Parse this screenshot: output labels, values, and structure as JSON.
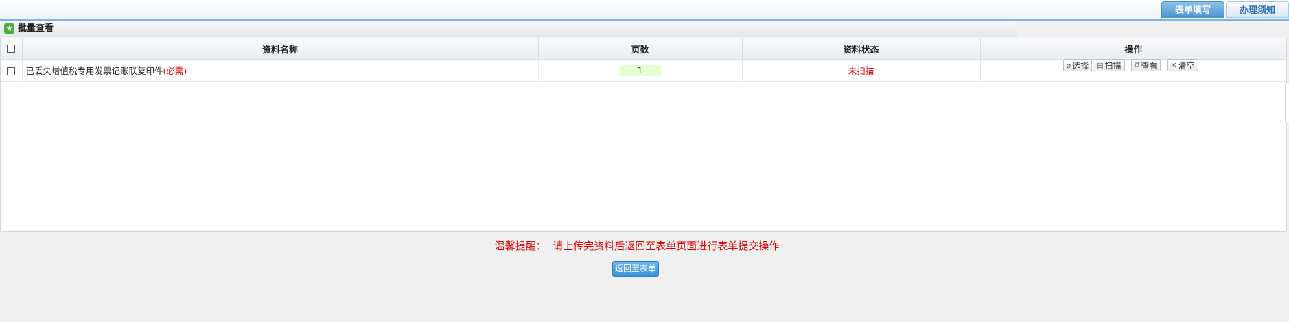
{
  "tabs": [
    {
      "label": "表单填写",
      "active": true
    },
    {
      "label": "办理须知",
      "active": false
    }
  ],
  "batch": {
    "label": "批量查看",
    "icon": "star-icon"
  },
  "grid": {
    "columns": [
      "资料名称",
      "页数",
      "资料状态",
      "操作"
    ],
    "rows": [
      {
        "name": "已丢失增值税专用发票记账联复印件",
        "required": "(必需)",
        "pages": "1",
        "status": "未扫描"
      }
    ],
    "operations": [
      {
        "label": "选择",
        "icon": "paperclip-icon"
      },
      {
        "label": "扫描",
        "icon": "scanner-icon"
      },
      {
        "label": "查看",
        "icon": "view-icon"
      },
      {
        "label": "清空",
        "icon": "clear-icon"
      }
    ]
  },
  "notice": "温馨提醒：  请上传完资料后返回至表单页面进行表单提交操作",
  "return_button": "返回至表单",
  "colors": {
    "accent": "#4e95d3",
    "warning": "#e00000"
  }
}
